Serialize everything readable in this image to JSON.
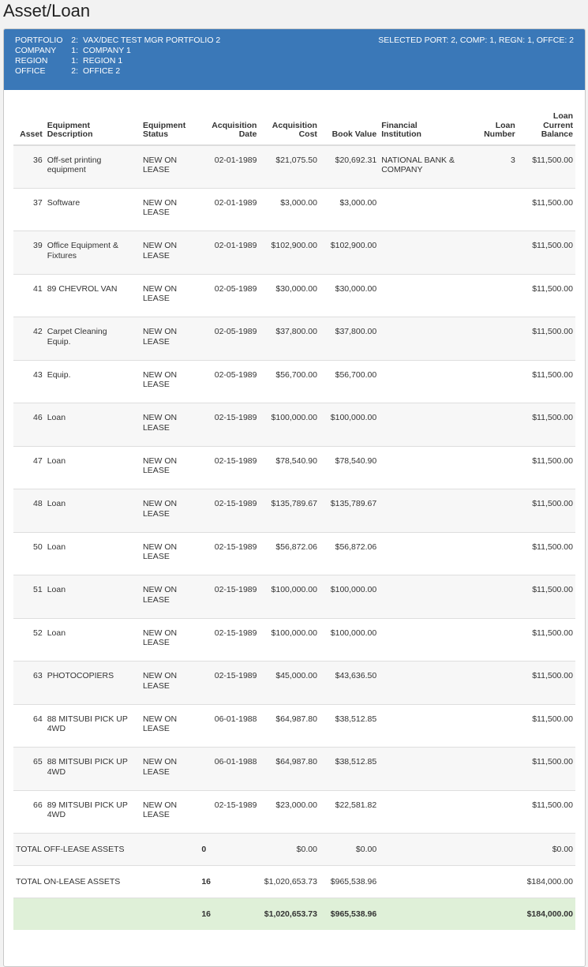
{
  "page": {
    "title": "Asset/Loan"
  },
  "header": {
    "rows": [
      {
        "label": "PORTFOLIO",
        "num": "2:",
        "value": "VAX/DEC TEST MGR PORTFOLIO 2"
      },
      {
        "label": "COMPANY",
        "num": "1:",
        "value": "COMPANY 1"
      },
      {
        "label": "REGION",
        "num": "1:",
        "value": "REGION 1"
      },
      {
        "label": "OFFICE",
        "num": "2:",
        "value": "OFFICE 2"
      }
    ],
    "selected": "SELECTED PORT: 2, COMP: 1, REGN: 1, OFFCE: 2"
  },
  "table": {
    "headers": {
      "asset": "Asset",
      "desc_1": "Equipment",
      "desc_2": "Description",
      "status_1": "Equipment",
      "status_2": "Status",
      "date_1": "Acquisition",
      "date_2": "Date",
      "cost_1": "Acquisition",
      "cost_2": "Cost",
      "book": "Book Value",
      "fin_1": "Financial",
      "fin_2": "Institution",
      "ln_1": "Loan",
      "ln_2": "Number",
      "bal_1": "Loan",
      "bal_2": "Current",
      "bal_3": "Balance"
    },
    "rows": [
      {
        "asset": "36",
        "desc_1": "Off-set printing",
        "desc_2": "equipment",
        "status_1": "NEW ON",
        "status_2": "LEASE",
        "date": "02-01-1989",
        "cost": "$21,075.50",
        "book": "$20,692.31",
        "fin_1": "NATIONAL BANK &",
        "fin_2": "COMPANY",
        "loan_no": "3",
        "balance": "$11,500.00"
      },
      {
        "asset": "37",
        "desc_1": "Software",
        "desc_2": "",
        "status_1": "NEW ON",
        "status_2": "LEASE",
        "date": "02-01-1989",
        "cost": "$3,000.00",
        "book": "$3,000.00",
        "fin_1": "",
        "fin_2": "",
        "loan_no": "",
        "balance": "$11,500.00"
      },
      {
        "asset": "39",
        "desc_1": "Office Equipment &",
        "desc_2": "Fixtures",
        "status_1": "NEW ON",
        "status_2": "LEASE",
        "date": "02-01-1989",
        "cost": "$102,900.00",
        "book": "$102,900.00",
        "fin_1": "",
        "fin_2": "",
        "loan_no": "",
        "balance": "$11,500.00"
      },
      {
        "asset": "41",
        "desc_1": "89 CHEVROL VAN",
        "desc_2": "",
        "status_1": "NEW ON",
        "status_2": "LEASE",
        "date": "02-05-1989",
        "cost": "$30,000.00",
        "book": "$30,000.00",
        "fin_1": "",
        "fin_2": "",
        "loan_no": "",
        "balance": "$11,500.00"
      },
      {
        "asset": "42",
        "desc_1": "Carpet Cleaning",
        "desc_2": "Equip.",
        "status_1": "NEW ON",
        "status_2": "LEASE",
        "date": "02-05-1989",
        "cost": "$37,800.00",
        "book": "$37,800.00",
        "fin_1": "",
        "fin_2": "",
        "loan_no": "",
        "balance": "$11,500.00"
      },
      {
        "asset": "43",
        "desc_1": "Equip.",
        "desc_2": "",
        "status_1": "NEW ON",
        "status_2": "LEASE",
        "date": "02-05-1989",
        "cost": "$56,700.00",
        "book": "$56,700.00",
        "fin_1": "",
        "fin_2": "",
        "loan_no": "",
        "balance": "$11,500.00"
      },
      {
        "asset": "46",
        "desc_1": "Loan",
        "desc_2": "",
        "status_1": "NEW ON",
        "status_2": "LEASE",
        "date": "02-15-1989",
        "cost": "$100,000.00",
        "book": "$100,000.00",
        "fin_1": "",
        "fin_2": "",
        "loan_no": "",
        "balance": "$11,500.00"
      },
      {
        "asset": "47",
        "desc_1": "Loan",
        "desc_2": "",
        "status_1": "NEW ON",
        "status_2": "LEASE",
        "date": "02-15-1989",
        "cost": "$78,540.90",
        "book": "$78,540.90",
        "fin_1": "",
        "fin_2": "",
        "loan_no": "",
        "balance": "$11,500.00"
      },
      {
        "asset": "48",
        "desc_1": "Loan",
        "desc_2": "",
        "status_1": "NEW ON",
        "status_2": "LEASE",
        "date": "02-15-1989",
        "cost": "$135,789.67",
        "book": "$135,789.67",
        "fin_1": "",
        "fin_2": "",
        "loan_no": "",
        "balance": "$11,500.00"
      },
      {
        "asset": "50",
        "desc_1": "Loan",
        "desc_2": "",
        "status_1": "NEW ON",
        "status_2": "LEASE",
        "date": "02-15-1989",
        "cost": "$56,872.06",
        "book": "$56,872.06",
        "fin_1": "",
        "fin_2": "",
        "loan_no": "",
        "balance": "$11,500.00"
      },
      {
        "asset": "51",
        "desc_1": "Loan",
        "desc_2": "",
        "status_1": "NEW ON",
        "status_2": "LEASE",
        "date": "02-15-1989",
        "cost": "$100,000.00",
        "book": "$100,000.00",
        "fin_1": "",
        "fin_2": "",
        "loan_no": "",
        "balance": "$11,500.00"
      },
      {
        "asset": "52",
        "desc_1": "Loan",
        "desc_2": "",
        "status_1": "NEW ON",
        "status_2": "LEASE",
        "date": "02-15-1989",
        "cost": "$100,000.00",
        "book": "$100,000.00",
        "fin_1": "",
        "fin_2": "",
        "loan_no": "",
        "balance": "$11,500.00"
      },
      {
        "asset": "63",
        "desc_1": "PHOTOCOPIERS",
        "desc_2": "",
        "status_1": "NEW ON",
        "status_2": "LEASE",
        "date": "02-15-1989",
        "cost": "$45,000.00",
        "book": "$43,636.50",
        "fin_1": "",
        "fin_2": "",
        "loan_no": "",
        "balance": "$11,500.00"
      },
      {
        "asset": "64",
        "desc_1": "88 MITSUBI PICK UP",
        "desc_2": "4WD",
        "status_1": "NEW ON",
        "status_2": "LEASE",
        "date": "06-01-1988",
        "cost": "$64,987.80",
        "book": "$38,512.85",
        "fin_1": "",
        "fin_2": "",
        "loan_no": "",
        "balance": "$11,500.00"
      },
      {
        "asset": "65",
        "desc_1": "88 MITSUBI PICK UP",
        "desc_2": "4WD",
        "status_1": "NEW ON",
        "status_2": "LEASE",
        "date": "06-01-1988",
        "cost": "$64,987.80",
        "book": "$38,512.85",
        "fin_1": "",
        "fin_2": "",
        "loan_no": "",
        "balance": "$11,500.00"
      },
      {
        "asset": "66",
        "desc_1": "89 MITSUBI PICK UP",
        "desc_2": "4WD",
        "status_1": "NEW ON",
        "status_2": "LEASE",
        "date": "02-15-1989",
        "cost": "$23,000.00",
        "book": "$22,581.82",
        "fin_1": "",
        "fin_2": "",
        "loan_no": "",
        "balance": "$11,500.00"
      }
    ],
    "totals": {
      "off": {
        "label": "TOTAL OFF-LEASE ASSETS",
        "count": "0",
        "cost": "$0.00",
        "book": "$0.00",
        "balance": "$0.00"
      },
      "on": {
        "label": "TOTAL ON-LEASE ASSETS",
        "count": "16",
        "cost": "$1,020,653.73",
        "book": "$965,538.96",
        "balance": "$184,000.00"
      },
      "grand": {
        "count": "16",
        "cost": "$1,020,653.73",
        "book": "$965,538.96",
        "balance": "$184,000.00"
      }
    }
  },
  "colors": {
    "header_bg": "#3a78b8",
    "grand_total_bg": "#dff0d8"
  }
}
